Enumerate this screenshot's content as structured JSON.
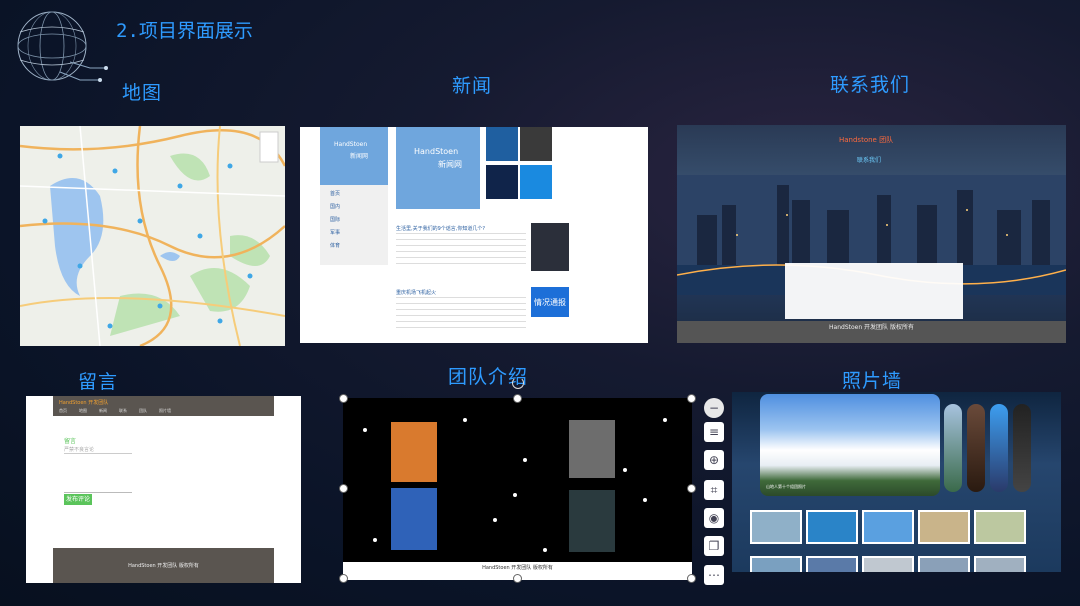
{
  "slide": {
    "title": "2.项目界面展示",
    "labels": {
      "map": "地图",
      "news": "新闻",
      "contact": "联系我们",
      "message": "留言",
      "team": "团队介绍",
      "photo": "照片墙"
    }
  },
  "news": {
    "logo_small": "HandStoen",
    "logo_small_sub": "新闻网",
    "logo_big": "HandStoen",
    "logo_big_sub": "新闻网",
    "side_items": [
      "首页",
      "国内",
      "国际",
      "军事",
      "体育"
    ],
    "article1_title": "生活里,关于我们的9个谣言,你知道几个?",
    "article2_title": "重庆机场飞机起火",
    "badge": "情况通报"
  },
  "contact": {
    "brand": "Handstone 团队",
    "section": "联系我们",
    "footer": "HandStoen 开发团队 版权所有"
  },
  "message": {
    "brand": "HandStoen 开发团队",
    "nav": [
      "首页",
      "地图",
      "新闻",
      "联系",
      "团队",
      "照片墙"
    ],
    "form_title": "留言",
    "placeholder": "严禁不良言论",
    "submit": "发布评论",
    "footer": "HandStoen 开发团队 版权所有"
  },
  "team": {
    "footer": "HandStoen 开发团队 版权所有"
  },
  "photo": {
    "caption": "山地人第十个组团照片"
  },
  "colors": {
    "accent": "#2e9bff",
    "submit_green": "#5bc45b"
  }
}
